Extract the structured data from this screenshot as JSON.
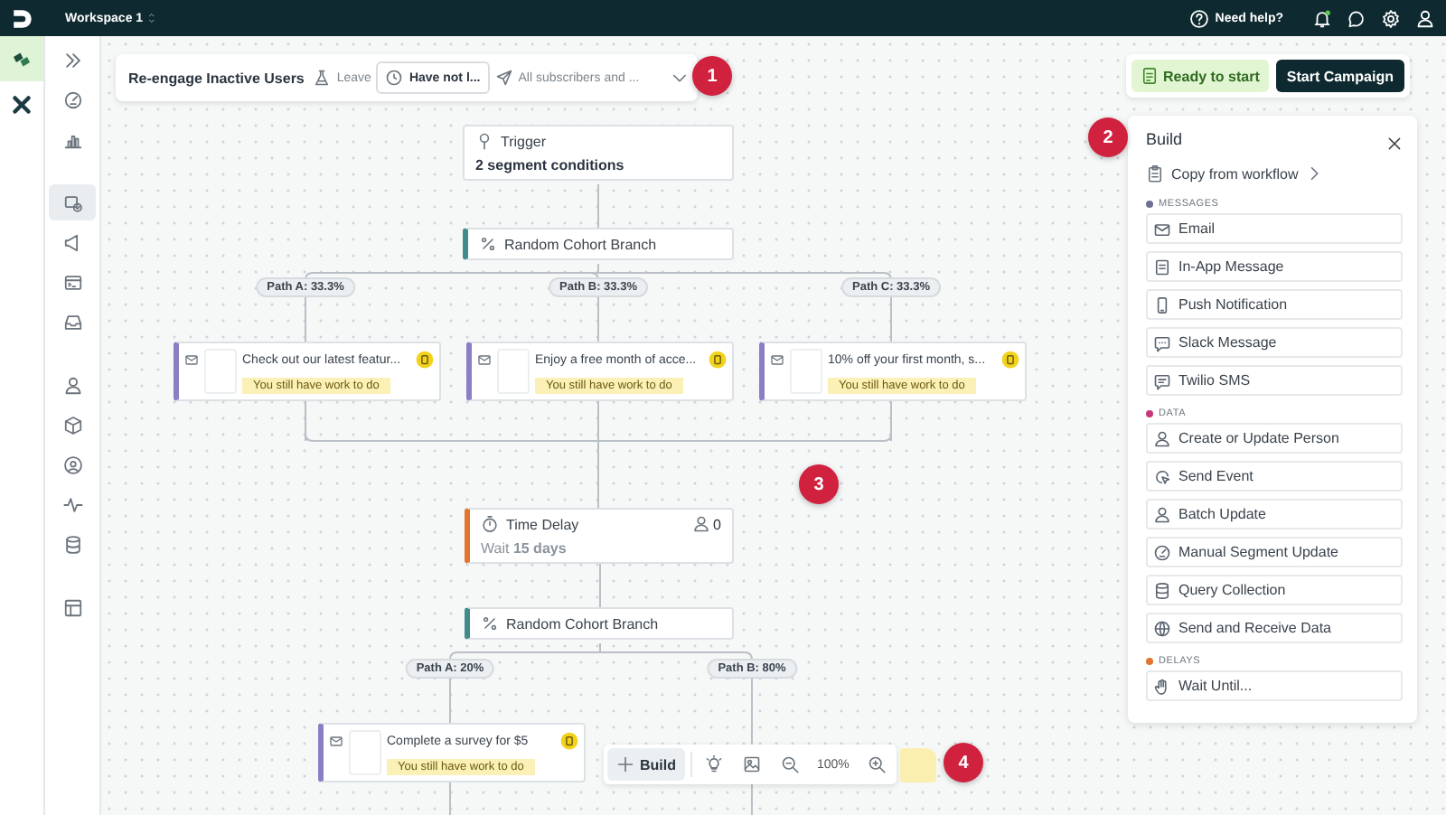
{
  "topbar": {
    "workspace": "Workspace 1",
    "help": "Need help?"
  },
  "rail": [
    {
      "selected": true
    },
    {
      "selected": false
    }
  ],
  "nav": [
    {
      "selected": false
    },
    {
      "selected": false
    },
    {
      "selected": false
    },
    {
      "selected": true
    },
    {
      "selected": false
    },
    {
      "selected": false
    },
    {
      "selected": false
    },
    {
      "selected": false
    },
    {
      "selected": false
    },
    {
      "selected": false
    },
    {
      "selected": false
    },
    {
      "selected": false
    },
    {
      "selected": false
    }
  ],
  "header": {
    "title": "Re-engage Inactive Users",
    "mode": "Leave",
    "filter": "Have not l...",
    "audience": "All subscribers and ..."
  },
  "status": {
    "label": "Ready to start",
    "button": "Start Campaign"
  },
  "workflow": [
    {
      "kind": "trigger",
      "title": "Trigger",
      "subtitle": "2 segment conditions"
    },
    {
      "kind": "branch",
      "title": "Random Cohort Branch",
      "paths": [
        {
          "label": "Path A: 33.3%",
          "steps": [
            {
              "kind": "message",
              "title": "Check out our latest featur...",
              "warning": "You still have work to do"
            }
          ]
        },
        {
          "label": "Path B: 33.3%",
          "steps": [
            {
              "kind": "message",
              "title": "Enjoy a free month of acce...",
              "warning": "You still have work to do"
            }
          ]
        },
        {
          "label": "Path C: 33.3%",
          "steps": [
            {
              "kind": "message",
              "title": "10% off your first month, s...",
              "warning": "You still have work to do"
            }
          ]
        }
      ]
    },
    {
      "kind": "delay",
      "title": "Time Delay",
      "detail": "Wait **15 days**",
      "count": "0"
    },
    {
      "kind": "branch",
      "title": "Random Cohort Branch",
      "paths": [
        {
          "label": "Path A: 20%",
          "steps": [
            {
              "kind": "message",
              "title": "Complete a survey for $5",
              "warning": "You still have work to do"
            }
          ]
        },
        {
          "label": "Path B: 80%"
        }
      ]
    }
  ],
  "build_panel": {
    "title": "Build",
    "copy": "Copy from workflow",
    "sections": [
      {
        "title": "MESSAGES",
        "color": "#6e7191",
        "items": [
          "Email",
          "In-App Message",
          "Push Notification",
          "Slack Message",
          "Twilio SMS"
        ]
      },
      {
        "title": "DATA",
        "color": "#c8397a",
        "items": [
          "Create or Update Person",
          "Send Event",
          "Batch Update",
          "Manual Segment Update",
          "Query Collection",
          "Send and Receive Data"
        ]
      },
      {
        "title": "DELAYS",
        "color": "#e0762f",
        "items": [
          "Wait Until..."
        ]
      }
    ]
  },
  "toolbar": {
    "build": "Build",
    "zoom": "100%"
  },
  "callouts": [
    "1",
    "2",
    "3",
    "4"
  ]
}
